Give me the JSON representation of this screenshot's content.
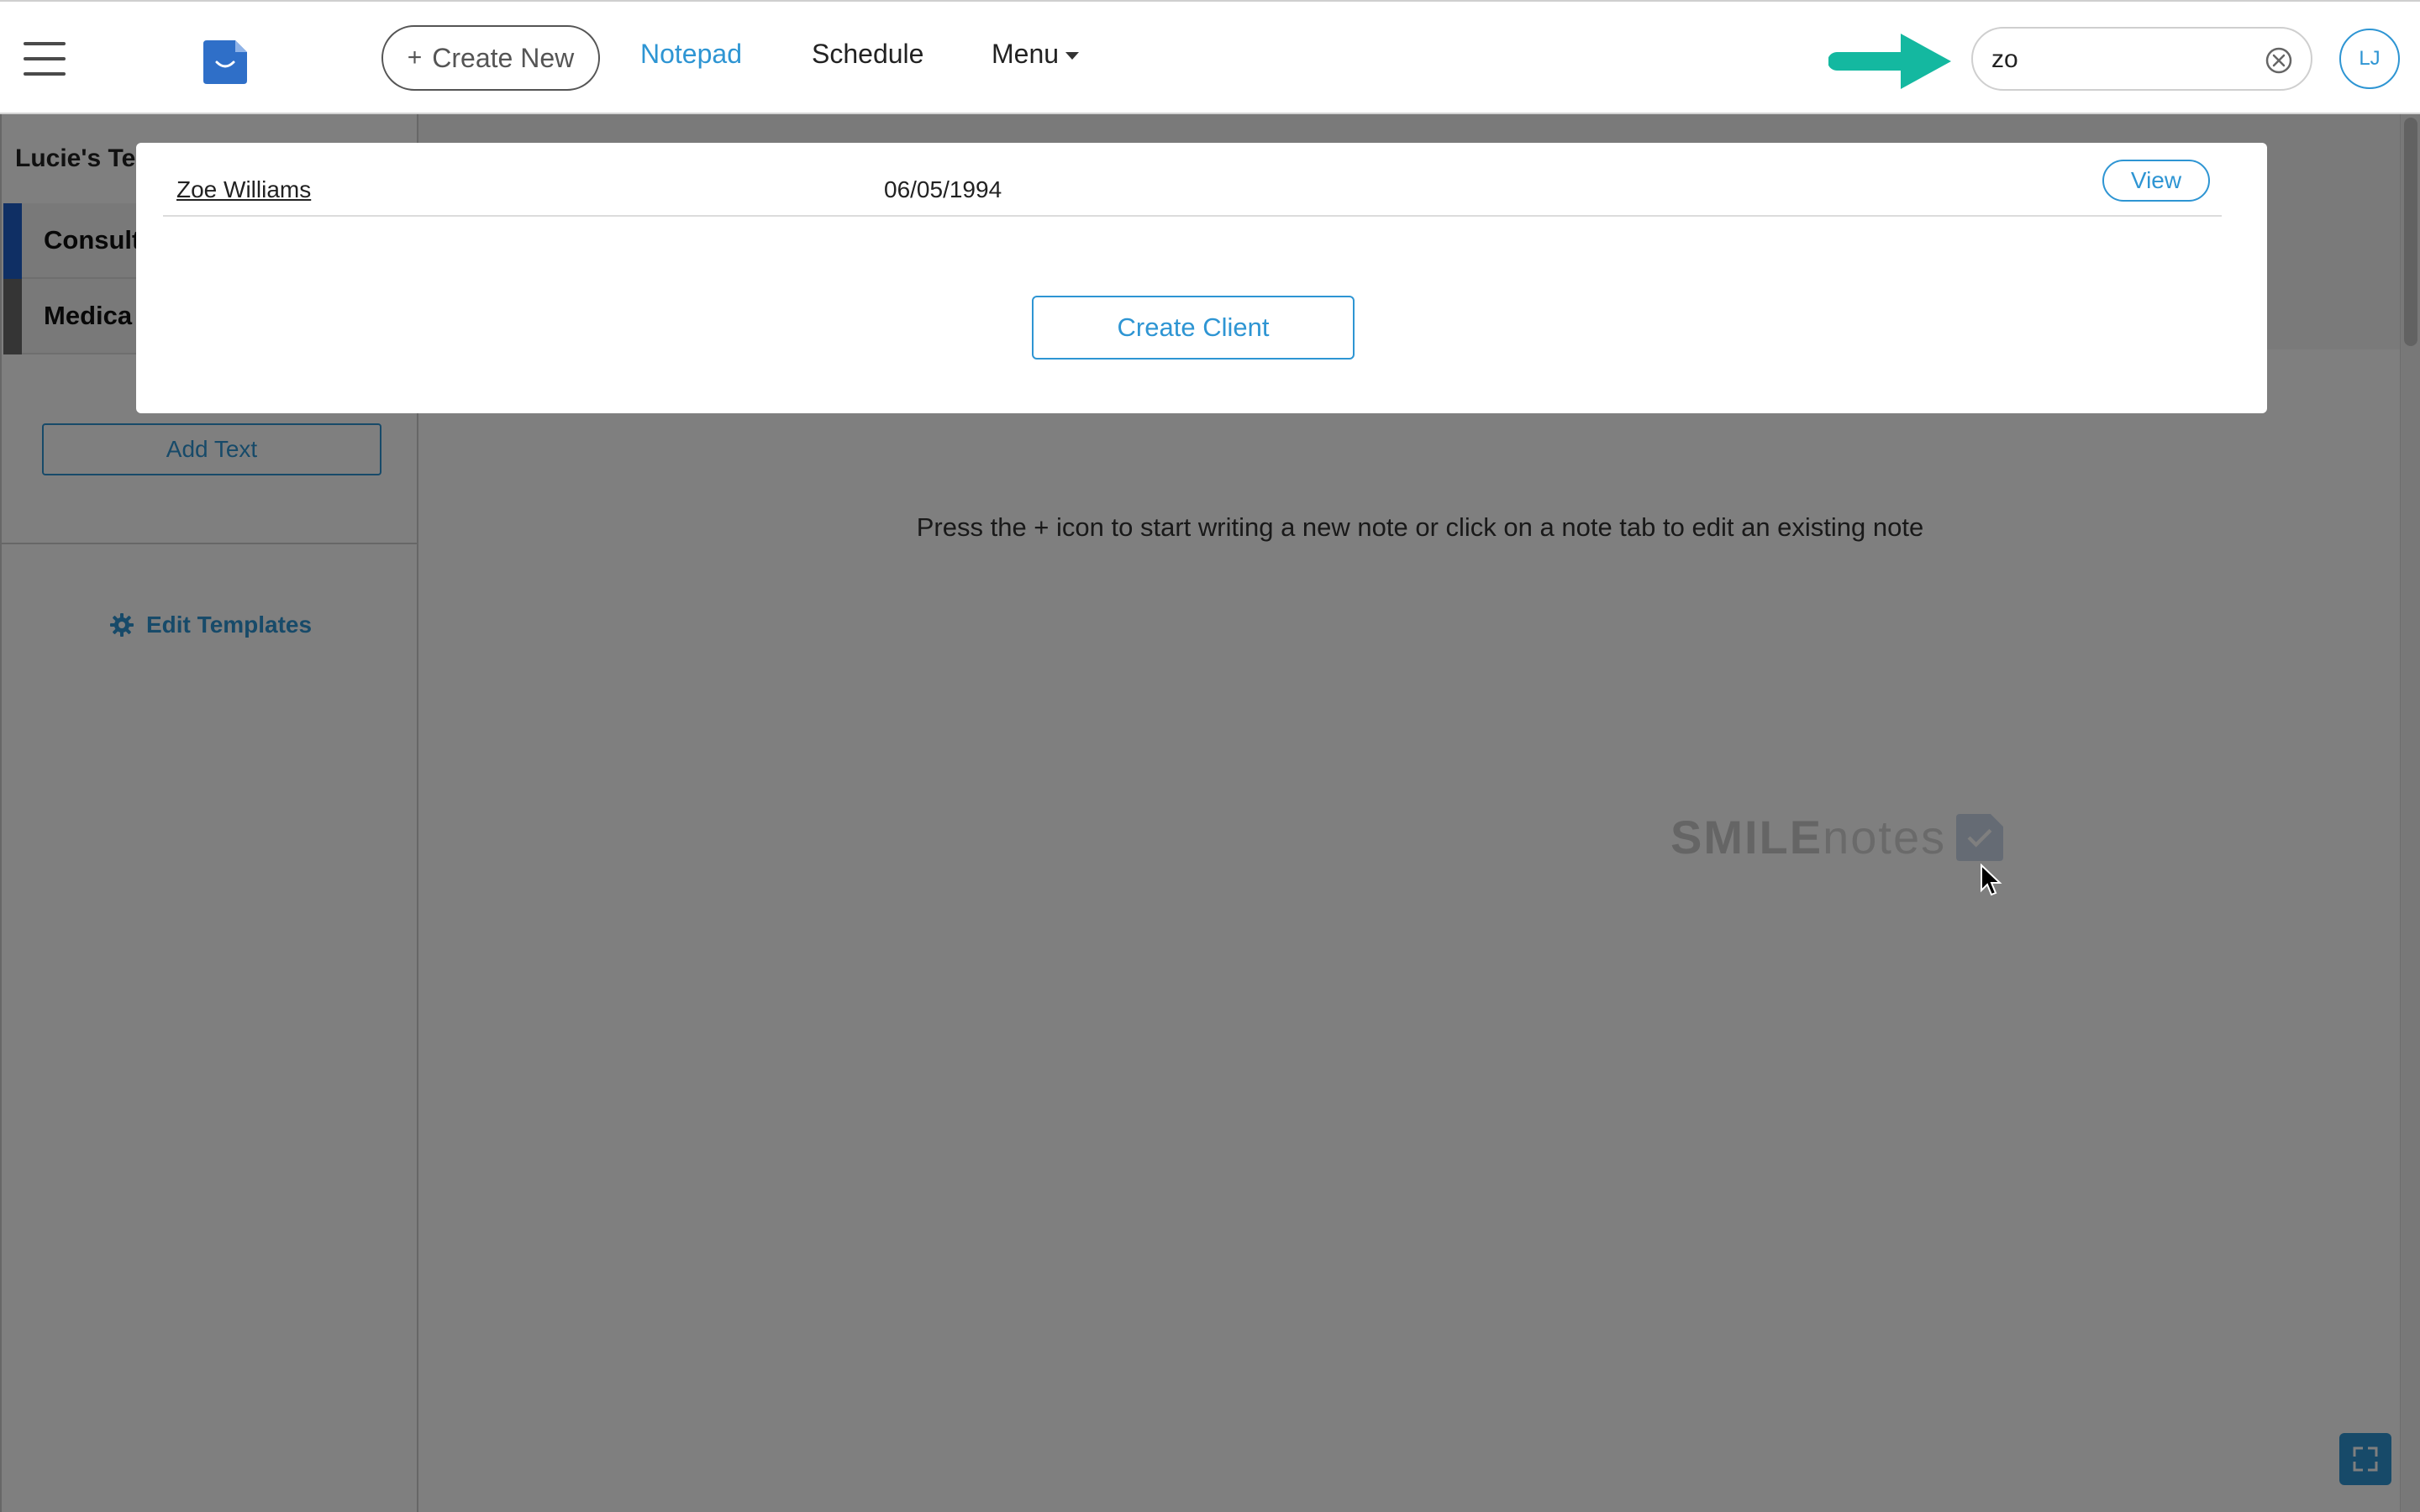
{
  "header": {
    "create_new_label": "Create New",
    "create_new_icon": "plus-icon",
    "nav": {
      "notepad": "Notepad",
      "schedule": "Schedule",
      "menu": "Menu"
    },
    "search": {
      "value": "zo",
      "placeholder": ""
    },
    "avatar_initials": "LJ",
    "colors": {
      "accent": "#2e95d3",
      "hint_arrow": "#14b8a0",
      "logo": "#2f6fc8"
    }
  },
  "sidebar": {
    "title": "Lucie's Te",
    "templates": [
      {
        "label": "Consult",
        "color": "#1f5fc8"
      },
      {
        "label": "Medica",
        "color": "#6a6a6a"
      }
    ],
    "add_text_label": "Add Text",
    "edit_templates_label": "Edit Templates",
    "edit_templates_icon": "gear-icon"
  },
  "main": {
    "empty_message": "Press the + icon to start writing a new note or click on a note tab to edit an existing note",
    "watermark_bold": "SMILE",
    "watermark_light": "notes"
  },
  "search_results": {
    "results": [
      {
        "name": "Zoe Williams",
        "dob": "06/05/1994",
        "action": "View"
      }
    ],
    "create_client_label": "Create Client"
  }
}
